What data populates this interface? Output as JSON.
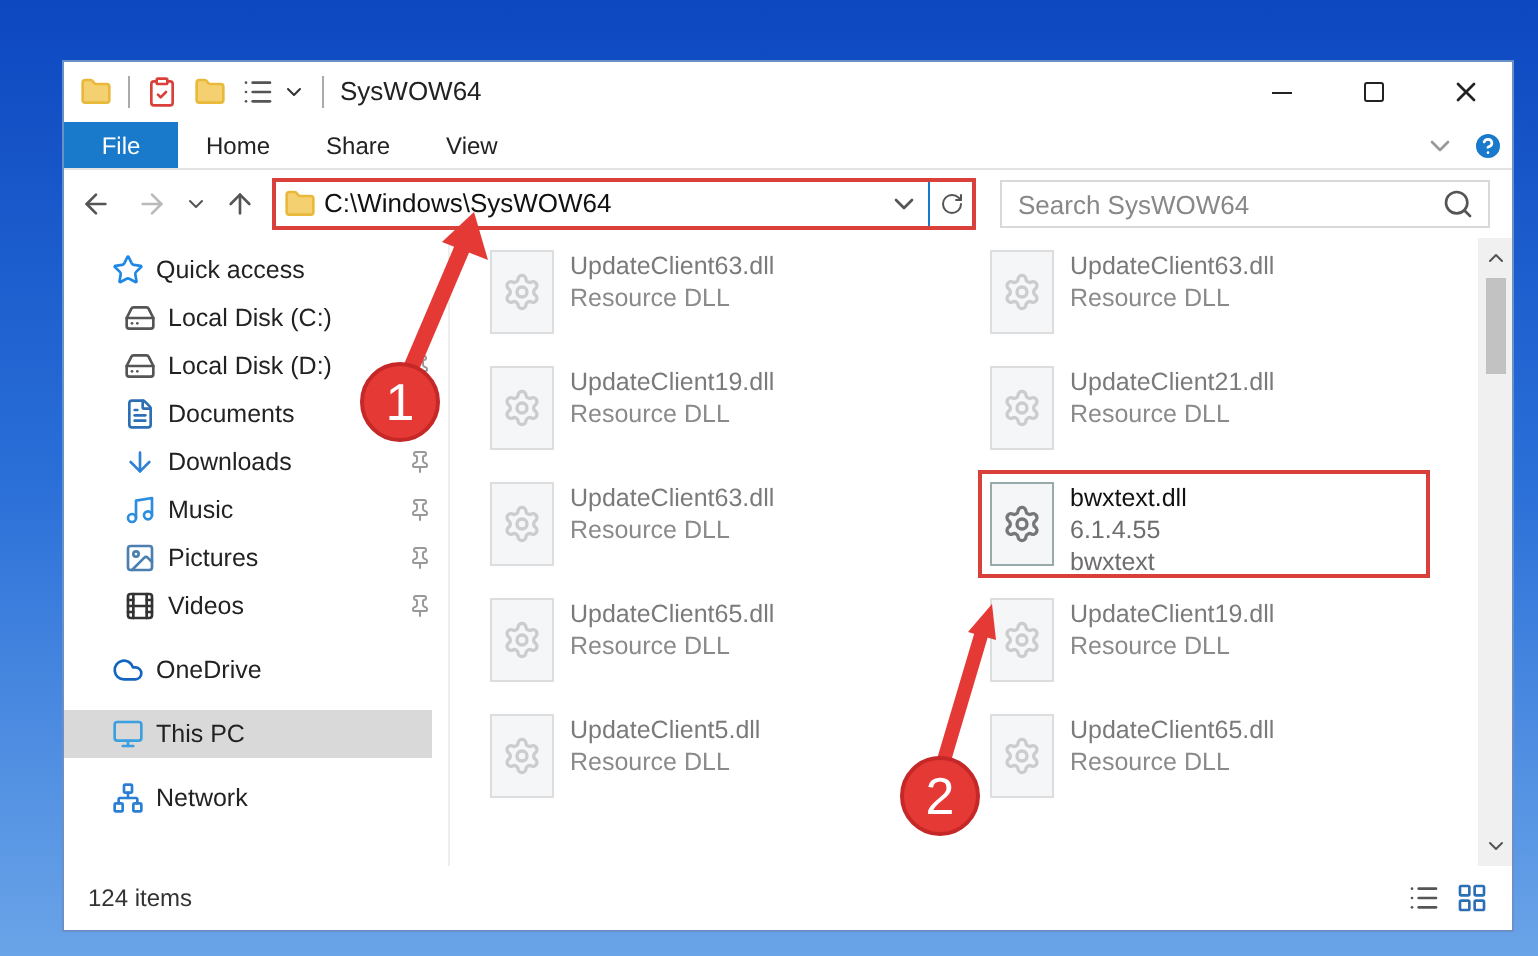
{
  "window": {
    "title": "SysWOW64"
  },
  "ribbon_tabs": [
    {
      "label": "File",
      "selected": true
    },
    {
      "label": "Home",
      "selected": false
    },
    {
      "label": "Share",
      "selected": false
    },
    {
      "label": "View",
      "selected": false
    }
  ],
  "address": {
    "path": "C:\\Windows\\SysWOW64",
    "highlighted": true
  },
  "search": {
    "placeholder": "Search SysWOW64"
  },
  "sidebar": {
    "items": [
      {
        "label": "Quick access",
        "kind": "star",
        "selected": false,
        "children": [
          {
            "label": "Local Disk (C:)",
            "kind": "drive",
            "selected": false,
            "pinned": false
          },
          {
            "label": "Local Disk (D:)",
            "kind": "drive",
            "selected": false,
            "pinned": true
          },
          {
            "label": "Documents",
            "kind": "document",
            "selected": false,
            "pinned": false
          },
          {
            "label": "Downloads",
            "kind": "download",
            "selected": false,
            "pinned": true
          },
          {
            "label": "Music",
            "kind": "music",
            "selected": false,
            "pinned": true
          },
          {
            "label": "Pictures",
            "kind": "pictures",
            "selected": false,
            "pinned": true
          },
          {
            "label": "Videos",
            "kind": "videos",
            "selected": false,
            "pinned": true
          }
        ]
      },
      {
        "label": "OneDrive",
        "kind": "cloud",
        "selected": false
      },
      {
        "label": "This PC",
        "kind": "pc",
        "selected": true
      },
      {
        "label": "Network",
        "kind": "network",
        "selected": false
      }
    ]
  },
  "files": [
    {
      "lines": [
        "UpdateClient63.dll",
        "Resource DLL"
      ],
      "faded": true,
      "highlighted": false
    },
    {
      "lines": [
        "UpdateClient63.dll",
        "Resource DLL"
      ],
      "faded": true,
      "highlighted": false
    },
    {
      "lines": [
        "UpdateClient19.dll",
        "Resource DLL"
      ],
      "faded": true,
      "highlighted": false
    },
    {
      "lines": [
        "UpdateClient21.dll",
        "Resource DLL"
      ],
      "faded": true,
      "highlighted": false
    },
    {
      "lines": [
        "UpdateClient63.dll",
        "Resource DLL"
      ],
      "faded": true,
      "highlighted": false
    },
    {
      "lines": [
        "bwxtext.dll",
        "6.1.4.55",
        "bwxtext"
      ],
      "faded": false,
      "highlighted": true
    },
    {
      "lines": [
        "UpdateClient65.dll",
        "Resource DLL"
      ],
      "faded": true,
      "highlighted": false
    },
    {
      "lines": [
        "UpdateClient19.dll",
        "Resource DLL"
      ],
      "faded": true,
      "highlighted": false
    },
    {
      "lines": [
        "UpdateClient5.dll",
        "Resource DLL"
      ],
      "faded": true,
      "highlighted": false
    },
    {
      "lines": [
        "UpdateClient65.dll",
        "Resource DLL"
      ],
      "faded": true,
      "highlighted": false
    }
  ],
  "status_bar": {
    "count": "124 items"
  },
  "annotations": [
    {
      "number": "1"
    },
    {
      "number": "2"
    }
  ]
}
